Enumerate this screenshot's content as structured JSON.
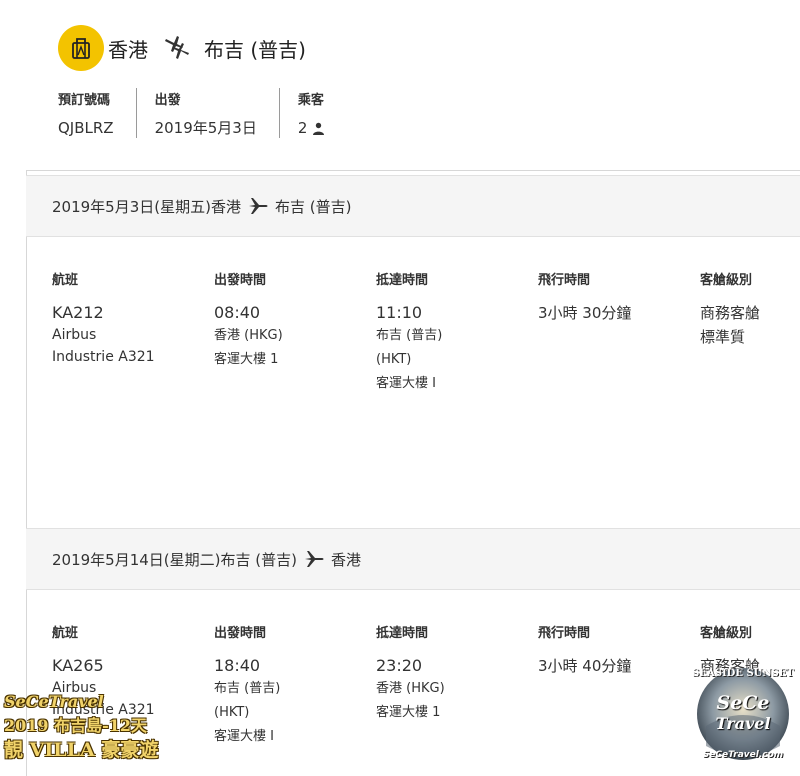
{
  "header": {
    "origin": "香港",
    "destination": "布吉 (普吉)",
    "accent_color": "#f3c300"
  },
  "booking": {
    "ref_label": "預訂號碼",
    "ref_value": "QJBLRZ",
    "depart_label": "出發",
    "depart_value": "2019年5月3日",
    "pax_label": "乘客",
    "pax_value": "2"
  },
  "legs": [
    {
      "date": "2019年5月3日(星期五)",
      "from": "香港",
      "to": "布吉 (普吉)",
      "col_flight": "航班",
      "col_depart": "出發時間",
      "col_arrive": "抵達時間",
      "col_duration": "飛行時間",
      "col_class": "客艙級別",
      "flight_no": "KA212",
      "aircraft_1": "Airbus",
      "aircraft_2": "Industrie A321",
      "depart_time": "08:40",
      "depart_place": "香港 (HKG)",
      "depart_terminal": "客運大樓 1",
      "arrive_time": "11:10",
      "arrive_place_1": "布吉 (普吉)",
      "arrive_place_2": "(HKT)",
      "arrive_terminal": "客運大樓 I",
      "duration": "3小時 30分鐘",
      "cabin_1": "商務客艙",
      "cabin_2": "標準質"
    },
    {
      "date": "2019年5月14日(星期二)",
      "from": "布吉 (普吉)",
      "to": "香港",
      "col_flight": "航班",
      "col_depart": "出發時間",
      "col_arrive": "抵達時間",
      "col_duration": "飛行時間",
      "col_class": "客艙級別",
      "flight_no": "KA265",
      "aircraft_1": "Airbus",
      "aircraft_2": "Industrie A321",
      "depart_time": "18:40",
      "depart_place_1": "布吉 (普吉)",
      "depart_place_2": "(HKT)",
      "depart_terminal": "客運大樓 I",
      "arrive_time": "23:20",
      "arrive_place": "香港 (HKG)",
      "arrive_terminal": "客運大樓 1",
      "duration": "3小時 40分鐘",
      "cabin_1": "商務客艙"
    }
  ],
  "watermark": {
    "line1": "SeCeTravel",
    "line2": "2019 布吉島-12天",
    "line3": "靚 VILLA 豪豪遊",
    "logo_top": "SEASIDE SUNSET",
    "logo_main_1": "SeCe",
    "logo_main_2": "Travel",
    "logo_bottom": "SeCeTravel.com"
  }
}
